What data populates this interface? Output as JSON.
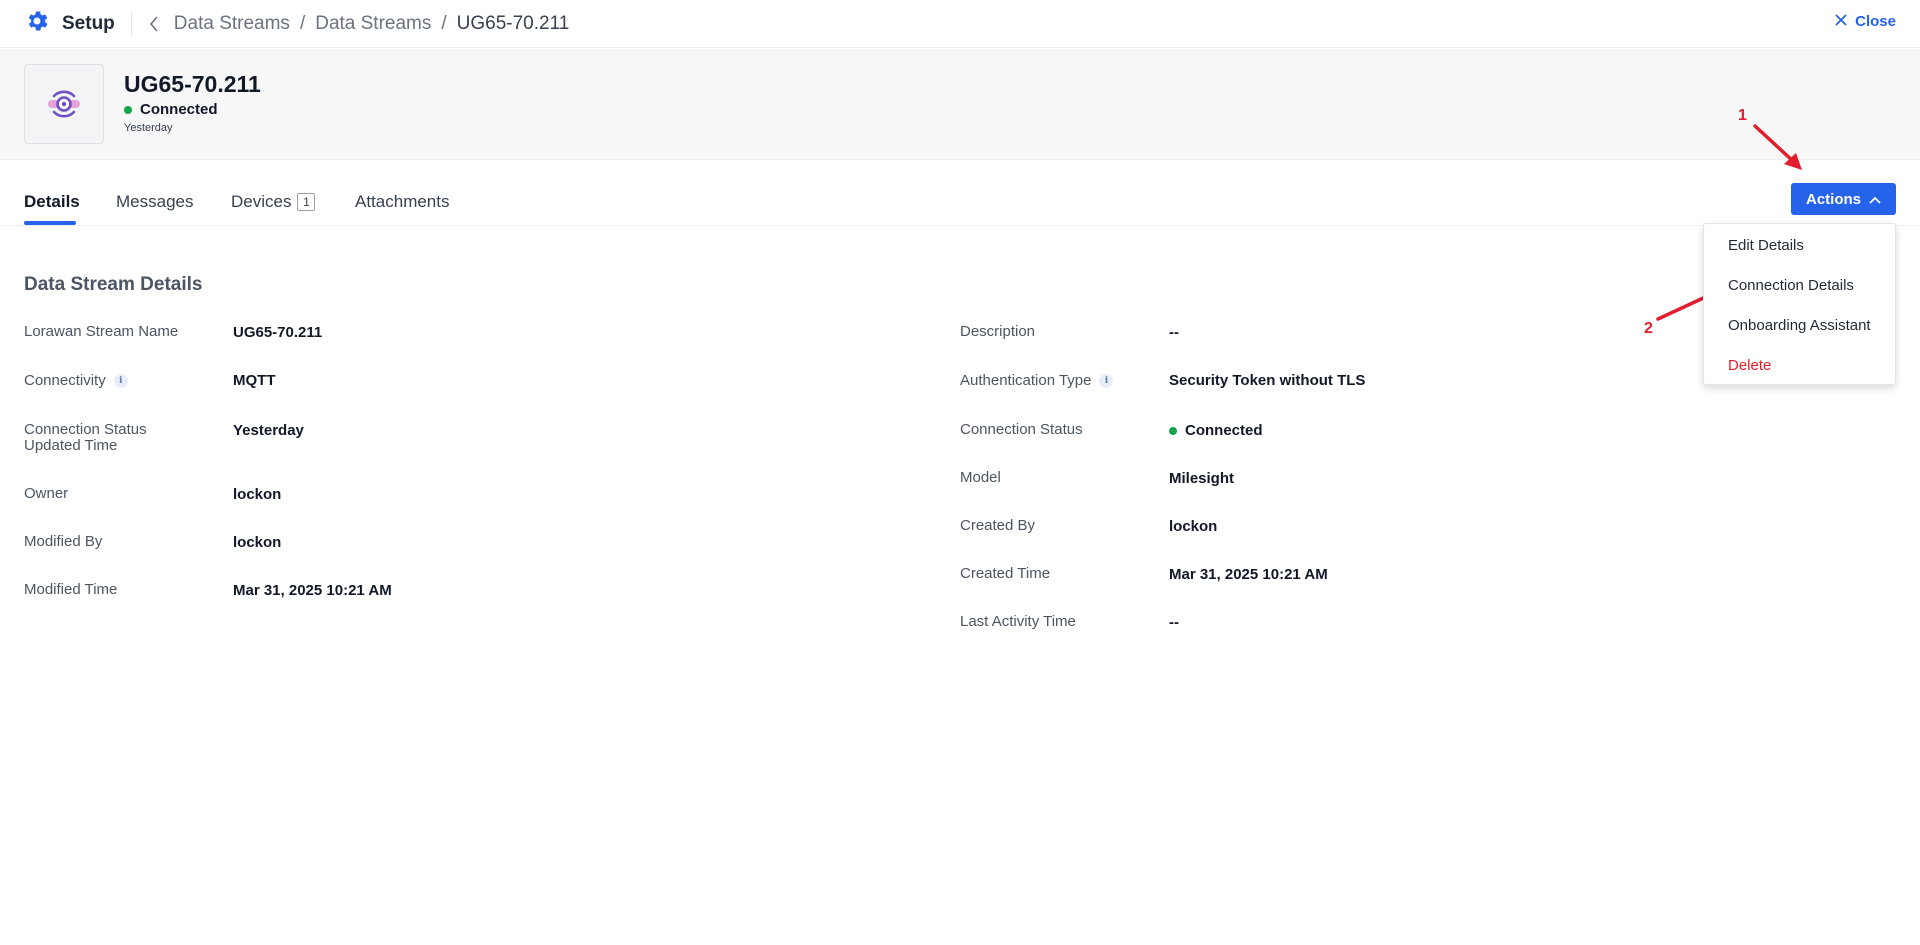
{
  "topbar": {
    "app_title": "Setup",
    "breadcrumbs": [
      "Data Streams",
      "Data Streams",
      "UG65-70.211"
    ],
    "breadcrumb_separator": "/",
    "close_label": "Close"
  },
  "header": {
    "title": "UG65-70.211",
    "status": "Connected",
    "updated": "Yesterday",
    "icon": "data-stream-icon"
  },
  "tabs": [
    {
      "label": "Details",
      "active": true
    },
    {
      "label": "Messages"
    },
    {
      "label": "Devices",
      "badge": "1"
    },
    {
      "label": "Attachments"
    }
  ],
  "actions": {
    "label": "Actions",
    "menu": [
      "Edit Details",
      "Connection Details",
      "Onboarding Assistant",
      "Delete"
    ]
  },
  "annotations": {
    "step1": "1",
    "step2": "2"
  },
  "details": {
    "section_title": "Data Stream Details",
    "left": [
      {
        "label": "Lorawan Stream Name",
        "value": "UG65-70.211"
      },
      {
        "label": "Connectivity",
        "value": "MQTT"
      },
      {
        "label": "Connection Status Updated Time",
        "value": "Yesterday"
      },
      {
        "label": "Owner",
        "value": "lockon"
      },
      {
        "label": "Modified By",
        "value": "lockon"
      },
      {
        "label": "Modified Time",
        "value": "Mar 31, 2025 10:21 AM"
      }
    ],
    "right": [
      {
        "label": "Description",
        "value": "--"
      },
      {
        "label": "Authentication Type",
        "value": "Security Token without TLS"
      },
      {
        "label": "Connection Status",
        "value": "Connected"
      },
      {
        "label": "Model",
        "value": "Milesight"
      },
      {
        "label": "Created By",
        "value": "lockon"
      },
      {
        "label": "Created Time",
        "value": "Mar 31, 2025 10:21 AM"
      },
      {
        "label": "Last Activity Time",
        "value": "--"
      }
    ]
  },
  "colors": {
    "accent": "#2563eb",
    "success": "#16a34a",
    "danger": "#e11d2e"
  }
}
